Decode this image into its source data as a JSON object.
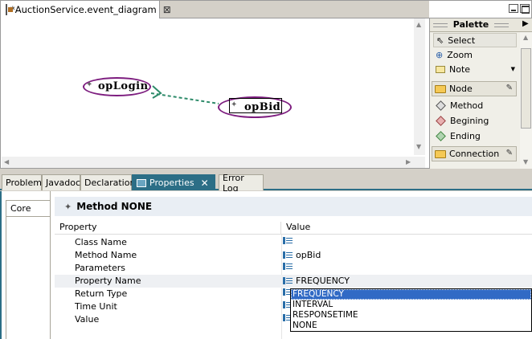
{
  "editor": {
    "tab_title": "*AuctionService.event_diagram",
    "close_glyph": "⊠"
  },
  "diagram": {
    "nodes": [
      {
        "label": "opLogin"
      },
      {
        "label": "opBid"
      }
    ]
  },
  "palette": {
    "title": "Palette",
    "tools": [
      {
        "label": "Select",
        "icon": "cursor-icon"
      },
      {
        "label": "Zoom",
        "icon": "zoom-icon"
      },
      {
        "label": "Note",
        "icon": "note-icon"
      }
    ],
    "drawers": [
      {
        "label": "Node",
        "items": [
          "Method",
          "Begining",
          "Ending"
        ]
      },
      {
        "label": "Connection"
      }
    ]
  },
  "views": {
    "tabs": [
      "Problems",
      "Javadoc",
      "Declaration",
      "Properties",
      "Error Log"
    ],
    "active": "Properties"
  },
  "properties": {
    "side_tab": "Core",
    "section_title": "Method NONE",
    "columns": {
      "property": "Property",
      "value": "Value"
    },
    "rows": [
      {
        "name": "Class Name",
        "value": ""
      },
      {
        "name": "Method Name",
        "value": "opBid"
      },
      {
        "name": "Parameters",
        "value": ""
      },
      {
        "name": "Property Name",
        "value": "FREQUENCY"
      },
      {
        "name": "Return Type",
        "value": ""
      },
      {
        "name": "Time Unit",
        "value": ""
      },
      {
        "name": "Value",
        "value": ""
      }
    ],
    "dropdown_options": [
      "FREQUENCY",
      "INTERVAL",
      "RESPONSETIME",
      "NONE"
    ],
    "dropdown_selected": "FREQUENCY"
  },
  "colors": {
    "node_border": "#7d1d7f",
    "connection": "#2e8b6a",
    "view_accent": "#2c6e86",
    "selection": "#316ac5"
  }
}
